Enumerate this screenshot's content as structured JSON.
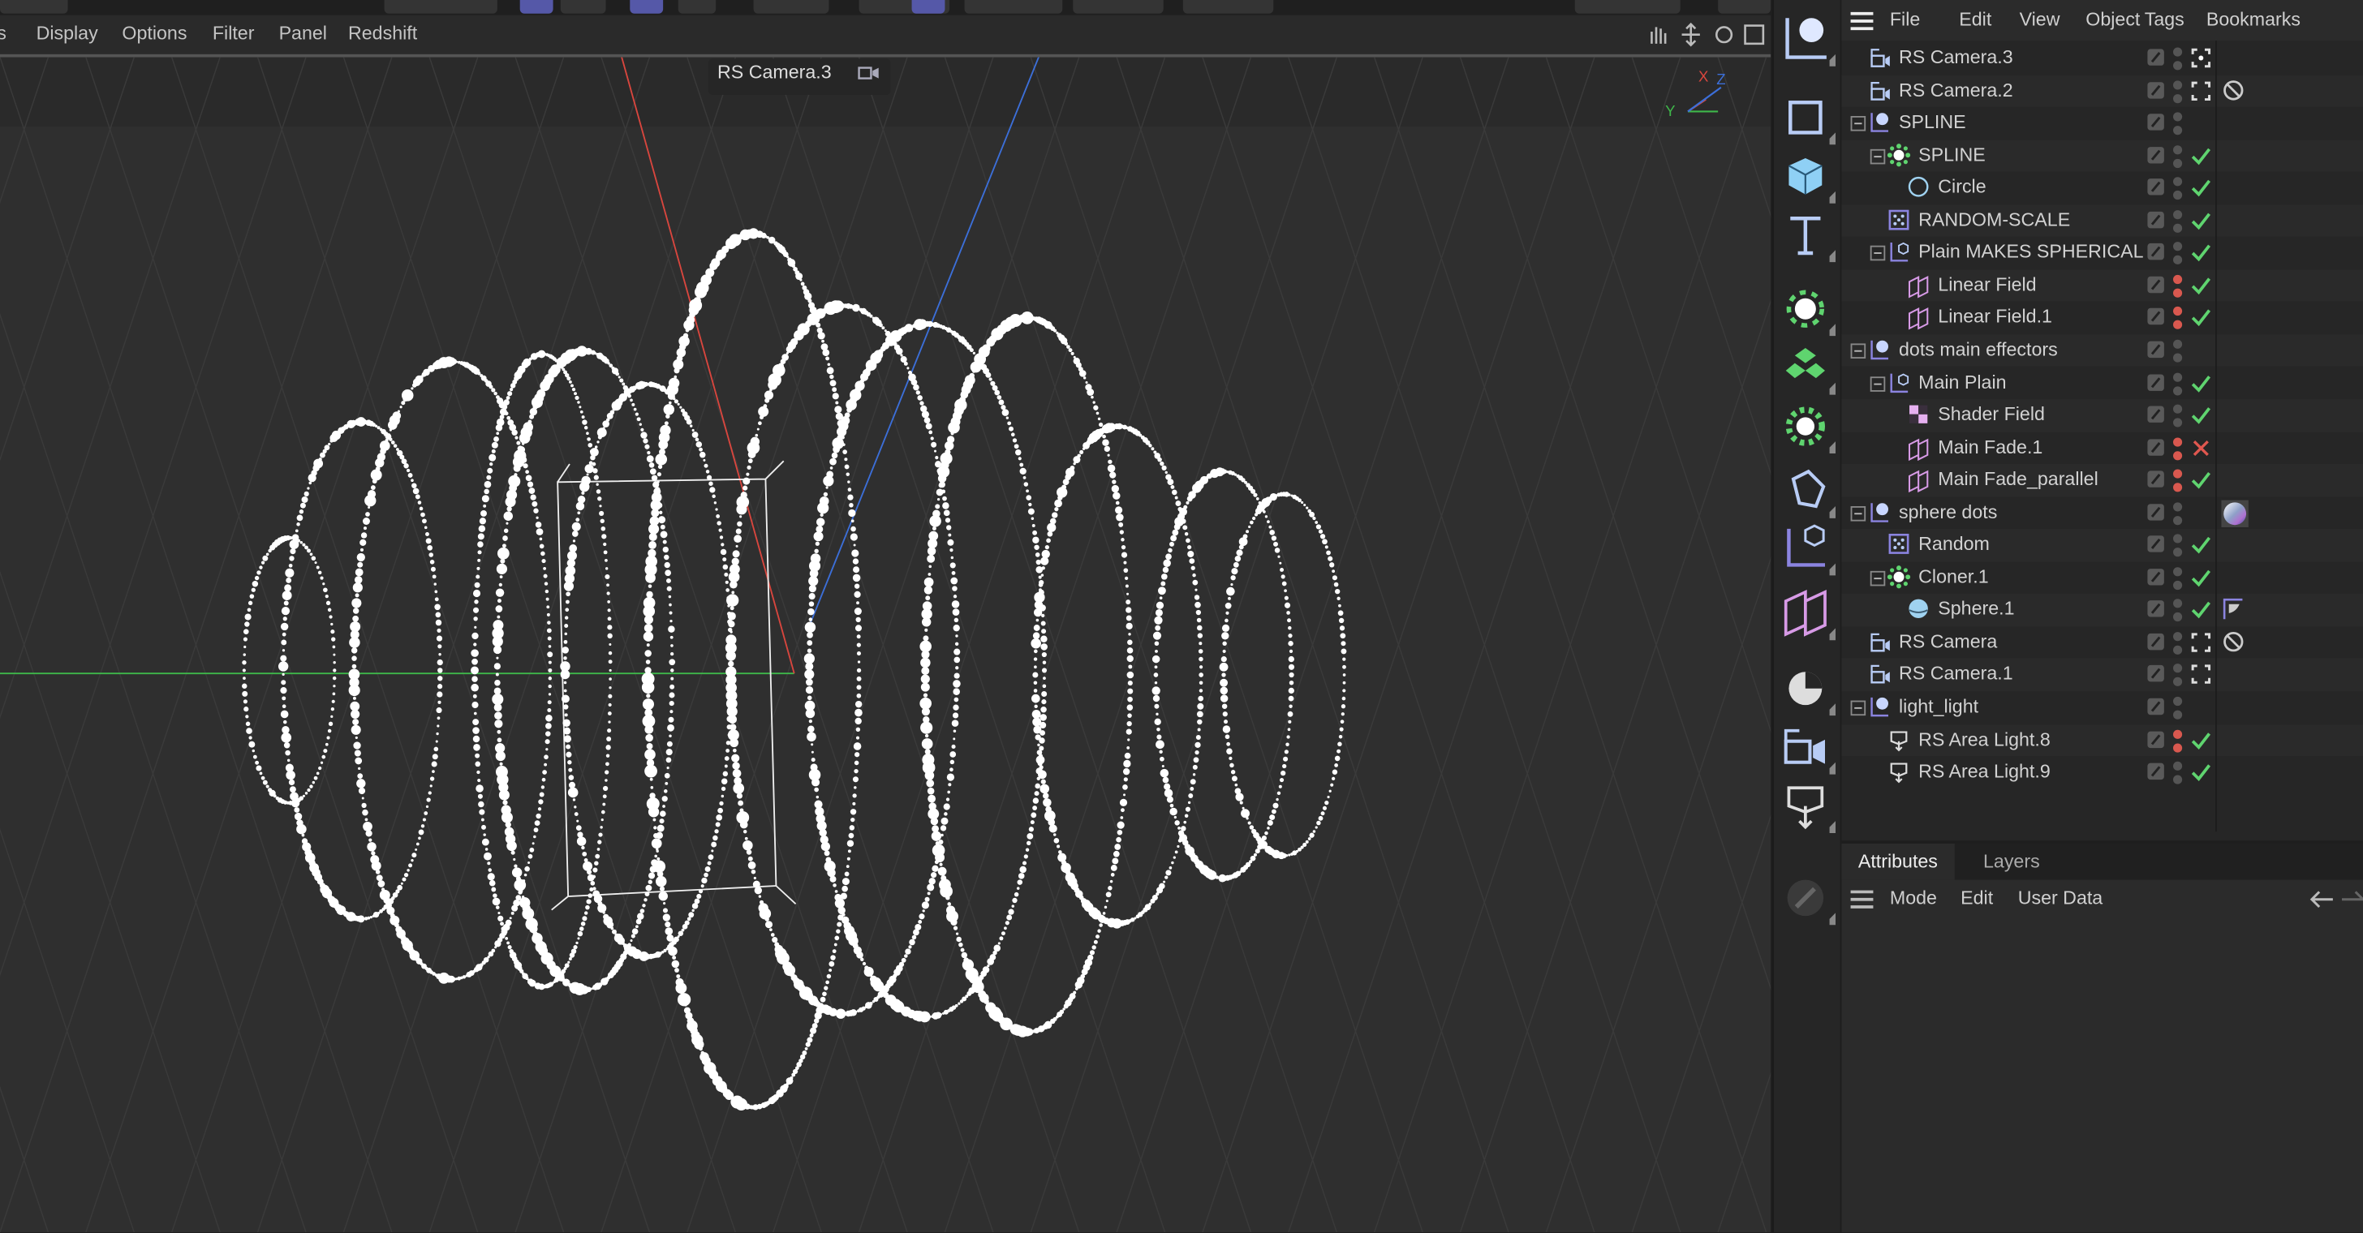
{
  "viewport": {
    "menu": [
      "s",
      "Display",
      "Options",
      "Filter",
      "Panel",
      "Redshift"
    ],
    "camera_label": "RS Camera.3",
    "axis_labels": {
      "x": "X",
      "y": "Y",
      "z": "Z"
    },
    "axis_colors": {
      "x": "#d9463e",
      "y": "#3fb84a",
      "z": "#3c6fd9"
    }
  },
  "sidebar": {
    "tools": [
      "spline-pen",
      "rectangle",
      "cube",
      "text",
      "cloner-mograph",
      "voronoi",
      "effector-gear",
      "deformer",
      "null-group",
      "field",
      "hdri-light",
      "camera",
      "area-light",
      "sculpt-disabled"
    ]
  },
  "object_manager": {
    "menu": [
      "File",
      "Edit",
      "View",
      "Object",
      "Tags",
      "Bookmarks"
    ],
    "rows": [
      {
        "name": "RS Camera.3",
        "indent": 0,
        "icon": "camera",
        "expander": false,
        "dots": "grey",
        "tag": "target-filled",
        "extra": ""
      },
      {
        "name": "RS Camera.2",
        "indent": 0,
        "icon": "camera",
        "expander": false,
        "dots": "grey",
        "tag": "target",
        "extra": "no-sign"
      },
      {
        "name": "SPLINE",
        "indent": 0,
        "icon": "null",
        "expander": true,
        "dots": "grey",
        "tag": "",
        "extra": ""
      },
      {
        "name": "SPLINE",
        "indent": 1,
        "icon": "cloner",
        "expander": true,
        "dots": "grey",
        "tag": "check",
        "extra": ""
      },
      {
        "name": "Circle",
        "indent": 2,
        "icon": "circle",
        "expander": false,
        "dots": "grey",
        "tag": "check",
        "extra": ""
      },
      {
        "name": "RANDOM-SCALE",
        "indent": 1,
        "icon": "random",
        "expander": false,
        "dots": "grey",
        "tag": "check",
        "extra": ""
      },
      {
        "name": "Plain MAKES SPHERICAL",
        "indent": 1,
        "icon": "plain",
        "expander": true,
        "dots": "grey",
        "tag": "check",
        "extra": ""
      },
      {
        "name": "Linear Field",
        "indent": 2,
        "icon": "linear-field",
        "expander": false,
        "dots": "red",
        "tag": "check",
        "extra": ""
      },
      {
        "name": "Linear Field.1",
        "indent": 2,
        "icon": "linear-field",
        "expander": false,
        "dots": "red",
        "tag": "check",
        "extra": ""
      },
      {
        "name": "dots main effectors",
        "indent": 0,
        "icon": "null",
        "expander": true,
        "dots": "grey",
        "tag": "",
        "extra": ""
      },
      {
        "name": "Main Plain",
        "indent": 1,
        "icon": "plain",
        "expander": true,
        "dots": "grey",
        "tag": "check",
        "extra": ""
      },
      {
        "name": "Shader Field",
        "indent": 2,
        "icon": "shader-field",
        "expander": false,
        "dots": "grey",
        "tag": "check",
        "extra": ""
      },
      {
        "name": "Main Fade.1",
        "indent": 2,
        "icon": "linear-field",
        "expander": false,
        "dots": "red",
        "tag": "cross",
        "extra": ""
      },
      {
        "name": "Main Fade_parallel",
        "indent": 2,
        "icon": "linear-field",
        "expander": false,
        "dots": "red",
        "tag": "check",
        "extra": ""
      },
      {
        "name": "sphere dots",
        "indent": 0,
        "icon": "null",
        "expander": true,
        "dots": "grey",
        "tag": "",
        "extra": "material"
      },
      {
        "name": "Random",
        "indent": 1,
        "icon": "random",
        "expander": false,
        "dots": "grey",
        "tag": "check",
        "extra": ""
      },
      {
        "name": "Cloner.1",
        "indent": 1,
        "icon": "cloner",
        "expander": true,
        "dots": "grey",
        "tag": "check",
        "extra": ""
      },
      {
        "name": "Sphere.1",
        "indent": 2,
        "icon": "sphere",
        "expander": false,
        "dots": "grey",
        "tag": "check",
        "extra": "phong"
      },
      {
        "name": "RS Camera",
        "indent": 0,
        "icon": "camera",
        "expander": false,
        "dots": "grey",
        "tag": "target",
        "extra": "no-sign"
      },
      {
        "name": "RS Camera.1",
        "indent": 0,
        "icon": "camera",
        "expander": false,
        "dots": "grey",
        "tag": "target",
        "extra": ""
      },
      {
        "name": "light_light",
        "indent": 0,
        "icon": "null",
        "expander": true,
        "dots": "grey",
        "tag": "",
        "extra": ""
      },
      {
        "name": "RS Area Light.8",
        "indent": 1,
        "icon": "area-light",
        "expander": false,
        "dots": "red",
        "tag": "check",
        "extra": ""
      },
      {
        "name": "RS Area Light.9",
        "indent": 1,
        "icon": "area-light",
        "expander": false,
        "dots": "grey",
        "tag": "check",
        "extra": ""
      }
    ]
  },
  "attributes": {
    "tabs": [
      "Attributes",
      "Layers"
    ],
    "menu": [
      "Mode",
      "Edit",
      "User Data"
    ]
  },
  "colors": {
    "check": "#5fd46f",
    "cross": "#e0574f",
    "dot_red": "#d9584f",
    "dot_grey": "#555555",
    "icon_blue": "#b8ccf5",
    "icon_purple": "#8b84e0",
    "icon_pink": "#d79ae6"
  }
}
